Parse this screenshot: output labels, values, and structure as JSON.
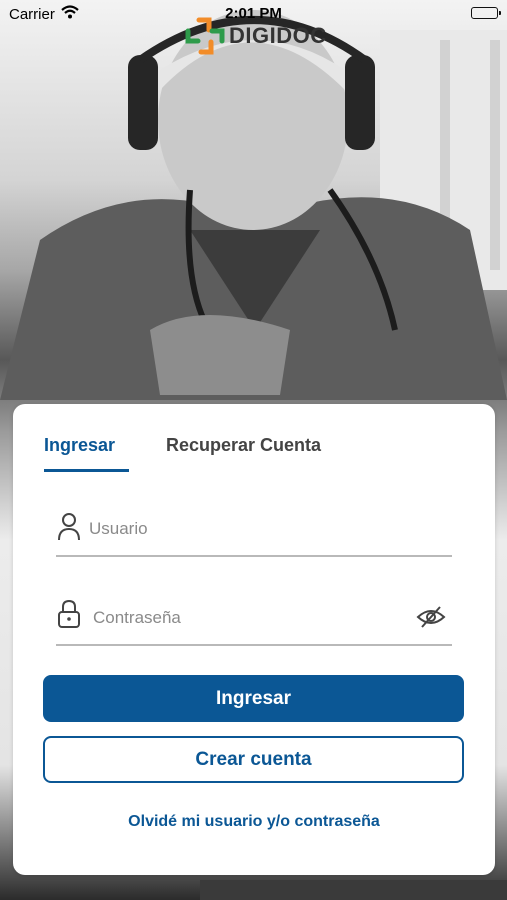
{
  "status_bar": {
    "carrier": "Carrier",
    "time": "2:01 PM"
  },
  "brand": {
    "name": "DIGIDOC",
    "colors": [
      "#f28c28",
      "#2e9b4b",
      "#0b5795"
    ]
  },
  "tabs": [
    {
      "label": "Ingresar",
      "active": true
    },
    {
      "label": "Recuperar Cuenta",
      "active": false
    }
  ],
  "form": {
    "username": {
      "placeholder": "Usuario",
      "value": "",
      "icon": "user-icon"
    },
    "password": {
      "placeholder": "Contraseña",
      "value": "",
      "icon": "lock-icon",
      "toggle_icon": "eye-off-icon"
    }
  },
  "buttons": {
    "login": "Ingresar",
    "create_account": "Crear cuenta"
  },
  "forgot_link": "Olvidé mi usuario y/o contraseña",
  "colors": {
    "primary": "#0b5795",
    "text_muted": "#8a8a8a",
    "tab_inactive": "#444444"
  }
}
